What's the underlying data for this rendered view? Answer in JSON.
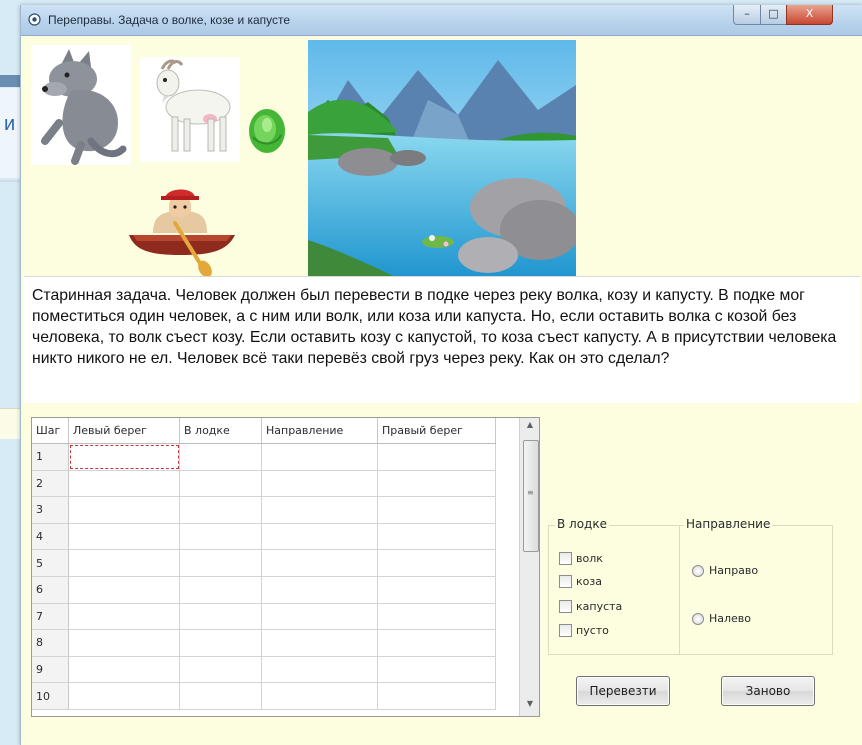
{
  "window": {
    "title": "Переправы. Задача о волке, козе и капусте",
    "controls": {
      "minimize": "–",
      "maximize": "□",
      "close": "X"
    }
  },
  "background": {
    "partial_text": "и"
  },
  "icons": [
    "app-icon",
    "wolf-icon",
    "goat-icon",
    "cabbage-icon",
    "man-in-boat-icon",
    "river-landscape-image"
  ],
  "task": {
    "text": "Старинная задача. Человек должен был перевести в подке через реку волка, козу и капусту. В подке мог поместиться один человек, а с ним или волк, или коза или капуста. Но, если оставить волка с козой без человека, то волк съест козу. Если оставить козу с капустой, то коза съест капусту. А в присутствии человека никто никого не ел. Человек всё таки перевёз свой груз через реку. Как он это сделал?"
  },
  "grid": {
    "columns": [
      "Шаг",
      "Левый берег",
      "В лодке",
      "Направление",
      "Правый берег"
    ],
    "rows": [
      [
        "1",
        "",
        "",
        "",
        ""
      ],
      [
        "2",
        "",
        "",
        "",
        ""
      ],
      [
        "3",
        "",
        "",
        "",
        ""
      ],
      [
        "4",
        "",
        "",
        "",
        ""
      ],
      [
        "5",
        "",
        "",
        "",
        ""
      ],
      [
        "6",
        "",
        "",
        "",
        ""
      ],
      [
        "7",
        "",
        "",
        "",
        ""
      ],
      [
        "8",
        "",
        "",
        "",
        ""
      ],
      [
        "9",
        "",
        "",
        "",
        ""
      ],
      [
        "10",
        "",
        "",
        "",
        ""
      ]
    ],
    "selected_cell": {
      "row": 1,
      "column": "Левый берег"
    }
  },
  "in_boat": {
    "title": "В лодке",
    "options": [
      {
        "label": "волк",
        "checked": false
      },
      {
        "label": "коза",
        "checked": false
      },
      {
        "label": "капуста",
        "checked": false
      },
      {
        "label": "пусто",
        "checked": false
      }
    ]
  },
  "direction": {
    "title": "Направление",
    "options": [
      {
        "label": "Направо",
        "selected": false
      },
      {
        "label": "Налево",
        "selected": false
      }
    ]
  },
  "buttons": {
    "transfer": "Перевезти",
    "reset": "Заново"
  },
  "colors": {
    "window_bg": "#fdfde0",
    "titlebar": "#b9d3ec",
    "close_button": "#c8472f",
    "selection_outline": "#c8333a"
  }
}
